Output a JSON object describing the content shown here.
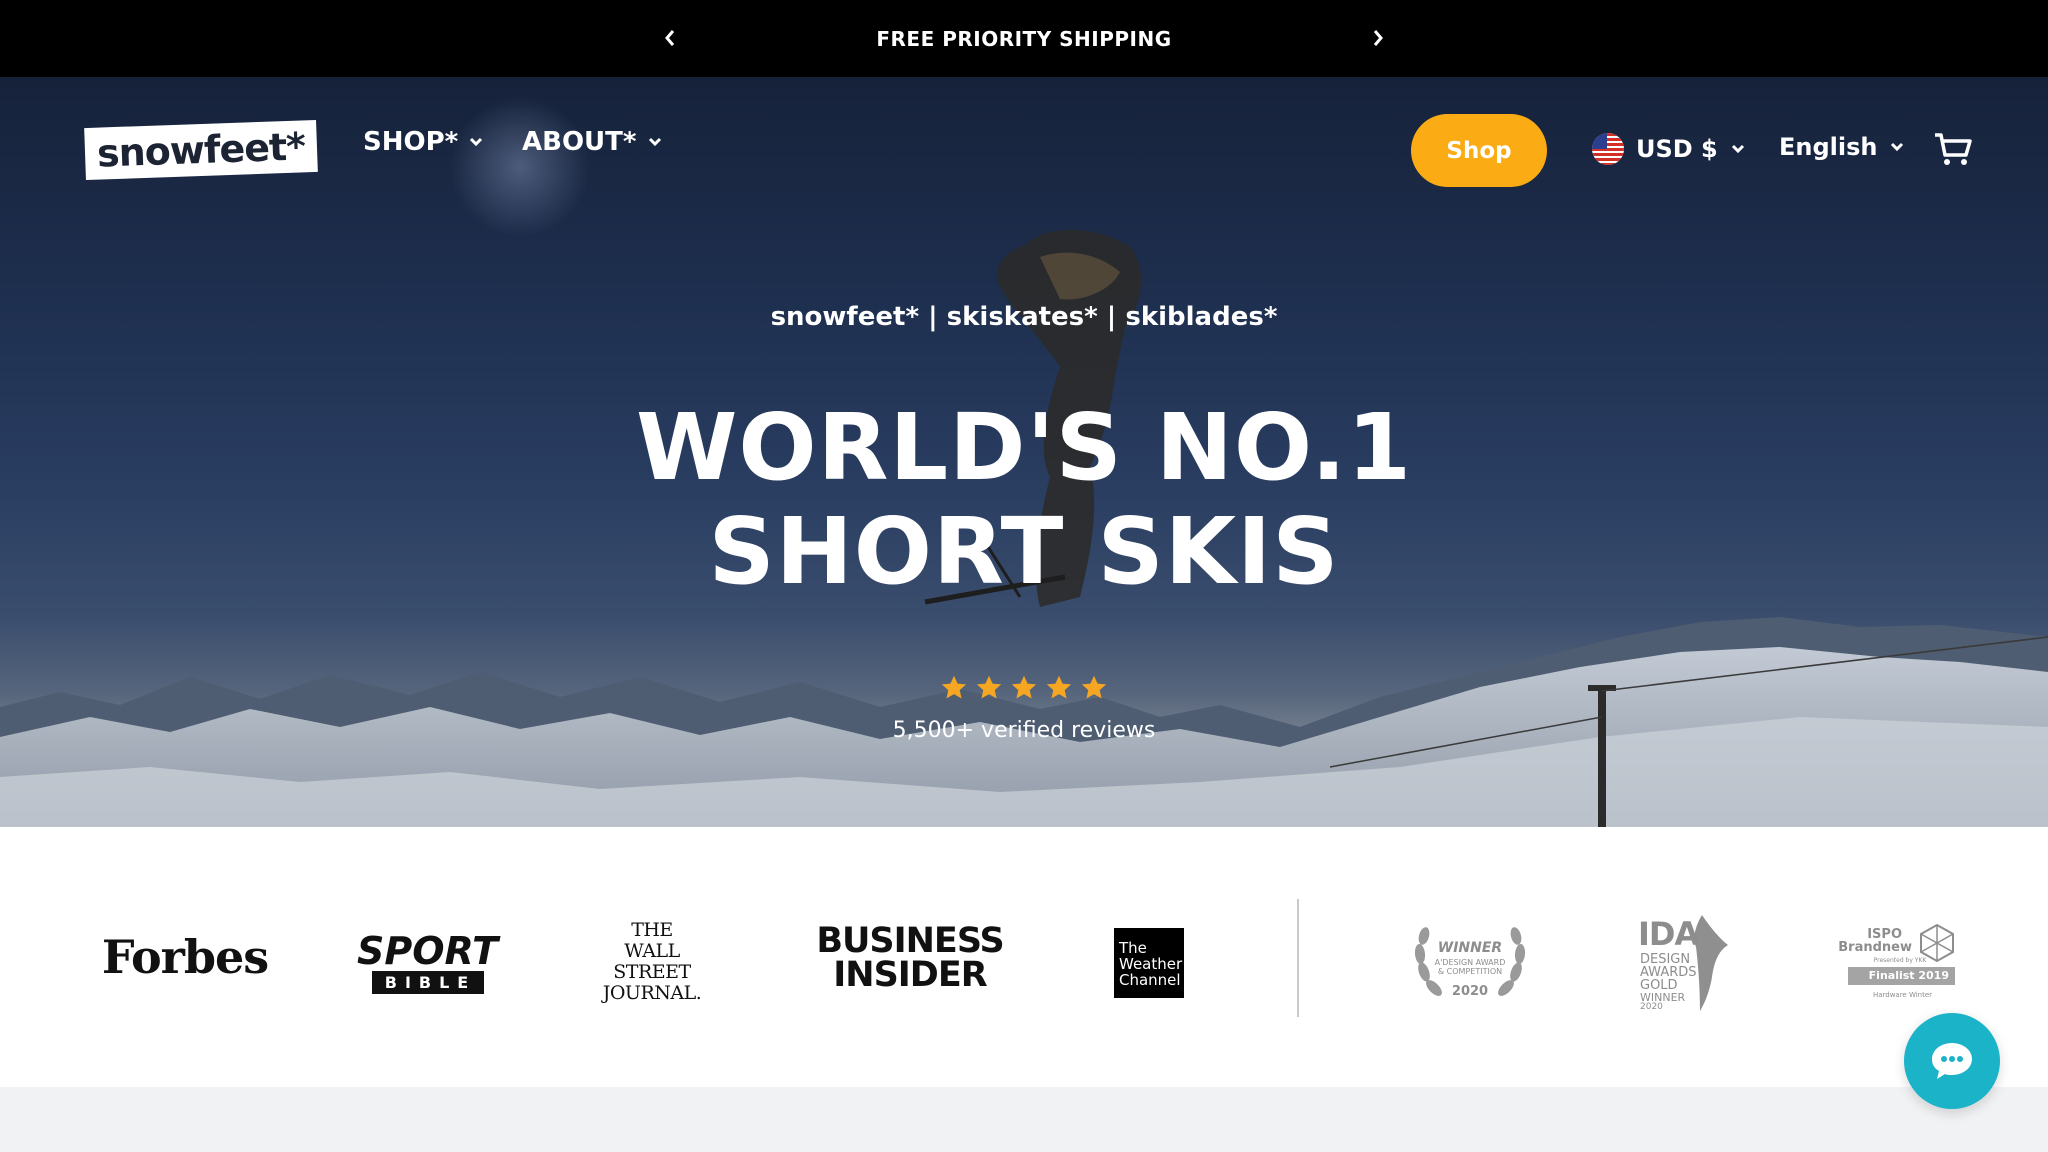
{
  "announcement": {
    "text": "FREE PRIORITY SHIPPING"
  },
  "header": {
    "logo": "snowfeet*",
    "nav": [
      {
        "label": "SHOP*"
      },
      {
        "label": "ABOUT*"
      }
    ],
    "shop_button": "Shop",
    "currency": "USD $",
    "language": "English"
  },
  "hero": {
    "subtitle": "snowfeet* | skiskates* | skiblades*",
    "title_line1": "WORLD'S NO.1",
    "title_line2": "SHORT SKIS",
    "rating": 5,
    "reviews": "5,500+ verified reviews"
  },
  "press": {
    "forbes": "Forbes",
    "sport_bible_top": "SPORT",
    "sport_bible_bottom": "BIBLE",
    "wsj": [
      "THE",
      "WALL STREET",
      "JOURNAL."
    ],
    "business_insider": [
      "BUSINESS",
      "INSIDER"
    ],
    "weather_channel": [
      "The",
      "Weather",
      "Channel"
    ],
    "adesign": {
      "title": "WINNER",
      "sub": [
        "A'DESIGN AWARD",
        "& COMPETITION"
      ],
      "year": "2020"
    },
    "ida": {
      "title": "IDA",
      "lines": [
        "DESIGN",
        "AWARDS",
        "GOLD",
        "WINNER",
        "2020"
      ]
    },
    "ispo": {
      "title": [
        "ISPO",
        "Brandnew"
      ],
      "presented": "Presented by YKK",
      "finalist": "Finalist 2019",
      "category": "Hardware Winter"
    }
  },
  "colors": {
    "accent": "#fbac14",
    "chat": "#1ab3c8",
    "star": "#f5a623"
  }
}
